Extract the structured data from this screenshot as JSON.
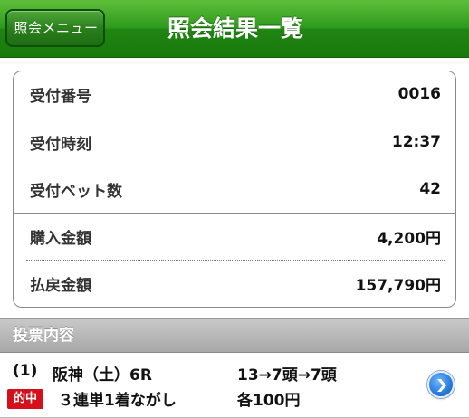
{
  "header": {
    "back_label": "照会メニュー",
    "title": "照会結果一覧",
    "bg_color": "#2f9a1e"
  },
  "summary": {
    "rows": [
      {
        "label": "受付番号",
        "value": "0016"
      },
      {
        "label": "受付時刻",
        "value": "12:37"
      },
      {
        "label": "受付ベット数",
        "value": "42"
      },
      {
        "label": "購入金額",
        "value": "4,200円"
      },
      {
        "label": "払戻金額",
        "value": "157,790円"
      }
    ]
  },
  "section": {
    "title": "投票内容"
  },
  "bets": [
    {
      "race_no": "(1)",
      "race_name": "阪神（土）6R",
      "combination": "13→7頭→7頭",
      "hit_badge": "的中",
      "bet_type": "３連単1着ながし",
      "amount": "各100円",
      "badge_color": "#d6101a"
    }
  ],
  "icons": {
    "detail": "chevron-right-circle-icon"
  }
}
